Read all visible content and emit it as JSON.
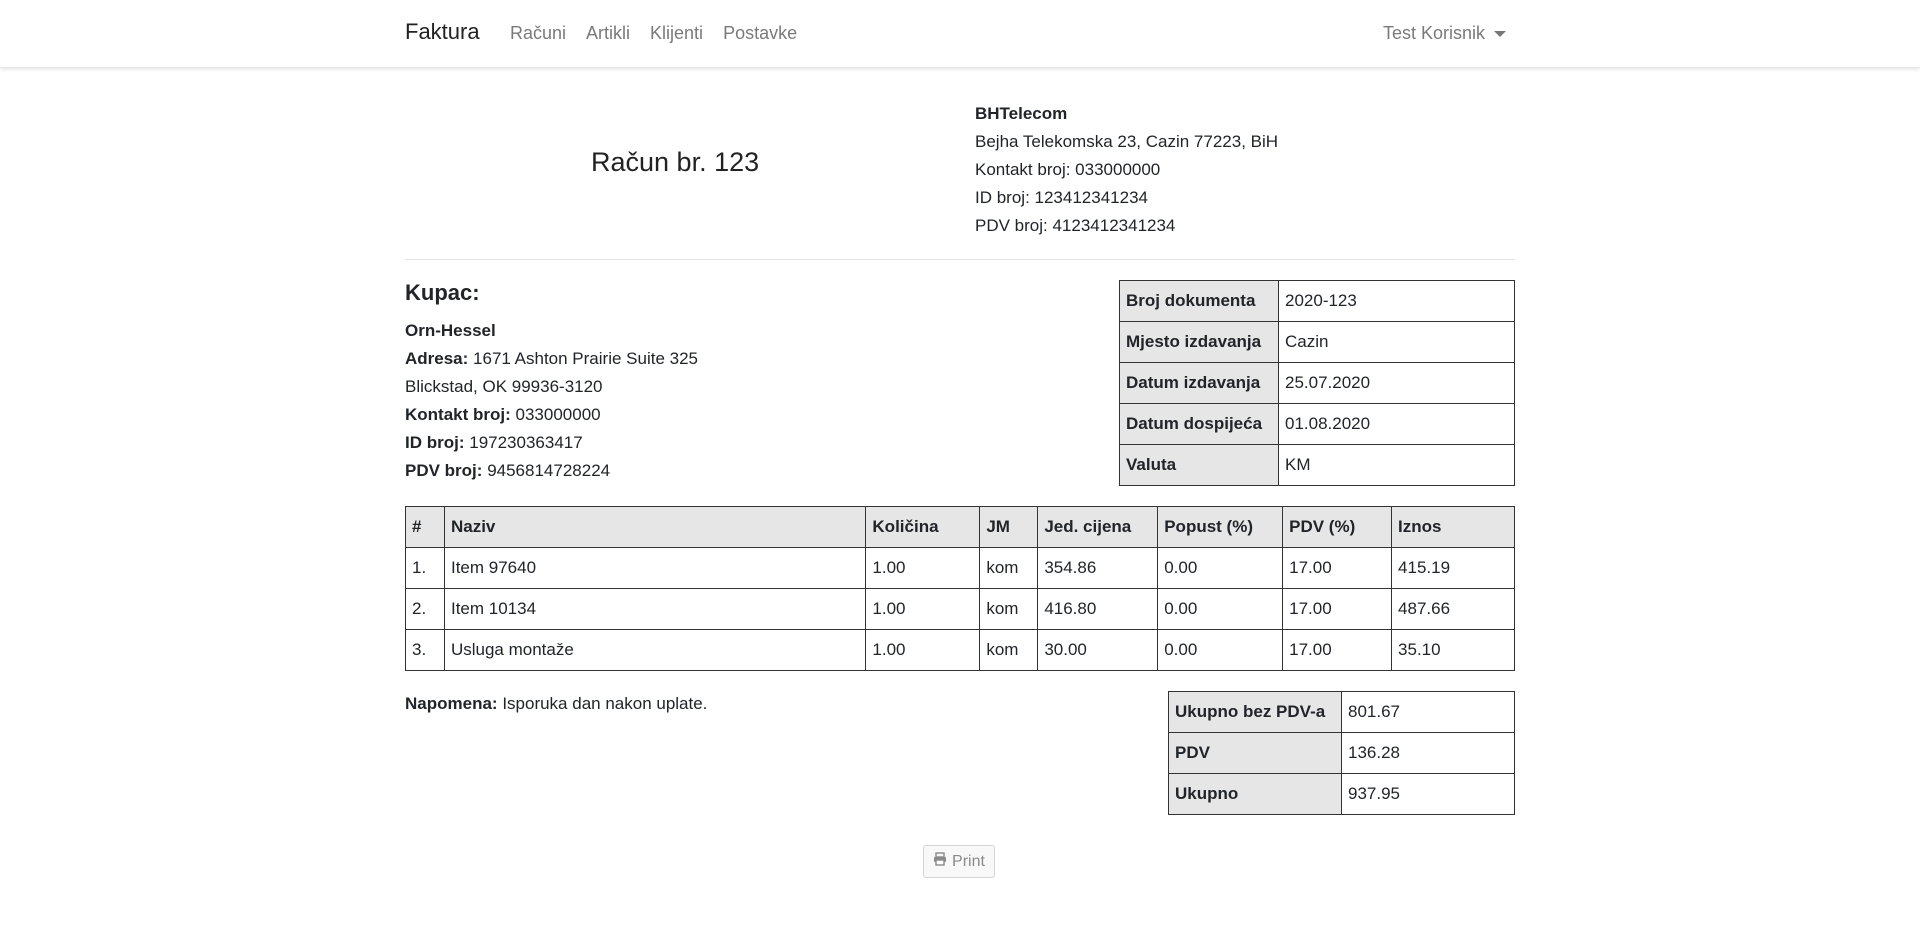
{
  "navbar": {
    "brand": "Faktura",
    "links": [
      "Računi",
      "Artikli",
      "Klijenti",
      "Postavke"
    ],
    "user": "Test Korisnik"
  },
  "invoice": {
    "title": "Račun br. 123"
  },
  "company": {
    "name": "BHTelecom",
    "address": "Bejha Telekomska 23, Cazin 77223, BiH",
    "contact": "Kontakt broj: 033000000",
    "id": "ID broj: 123412341234",
    "pdv": "PDV broj: 4123412341234"
  },
  "buyer": {
    "heading": "Kupac:",
    "name": "Orn-Hessel",
    "address_label": "Adresa:",
    "address_line1": "1671 Ashton Prairie Suite 325",
    "address_line2": "Blickstad, OK 99936-3120",
    "contact_label": "Kontakt broj:",
    "contact": "033000000",
    "id_label": "ID broj:",
    "id": "197230363417",
    "pdv_label": "PDV broj:",
    "pdv": "9456814728224"
  },
  "document": [
    {
      "label": "Broj dokumenta",
      "value": "2020-123"
    },
    {
      "label": "Mjesto izdavanja",
      "value": "Cazin"
    },
    {
      "label": "Datum izdavanja",
      "value": "25.07.2020"
    },
    {
      "label": "Datum dospijeća",
      "value": "01.08.2020"
    },
    {
      "label": "Valuta",
      "value": "KM"
    }
  ],
  "items": {
    "headers": [
      "#",
      "Naziv",
      "Količina",
      "JM",
      "Jed. cijena",
      "Popust (%)",
      "PDV (%)",
      "Iznos"
    ],
    "rows": [
      [
        "1.",
        "Item 97640",
        "1.00",
        "kom",
        "354.86",
        "0.00",
        "17.00",
        "415.19"
      ],
      [
        "2.",
        "Item 10134",
        "1.00",
        "kom",
        "416.80",
        "0.00",
        "17.00",
        "487.66"
      ],
      [
        "3.",
        "Usluga montaže",
        "1.00",
        "kom",
        "30.00",
        "0.00",
        "17.00",
        "35.10"
      ]
    ]
  },
  "note": {
    "label": "Napomena:",
    "text": "Isporuka dan nakon uplate."
  },
  "totals": [
    {
      "label": "Ukupno bez PDV-a",
      "value": "801.67"
    },
    {
      "label": "PDV",
      "value": "136.28"
    },
    {
      "label": "Ukupno",
      "value": "937.95"
    }
  ],
  "print_button": {
    "label": "Print",
    "icon": "print-icon"
  }
}
